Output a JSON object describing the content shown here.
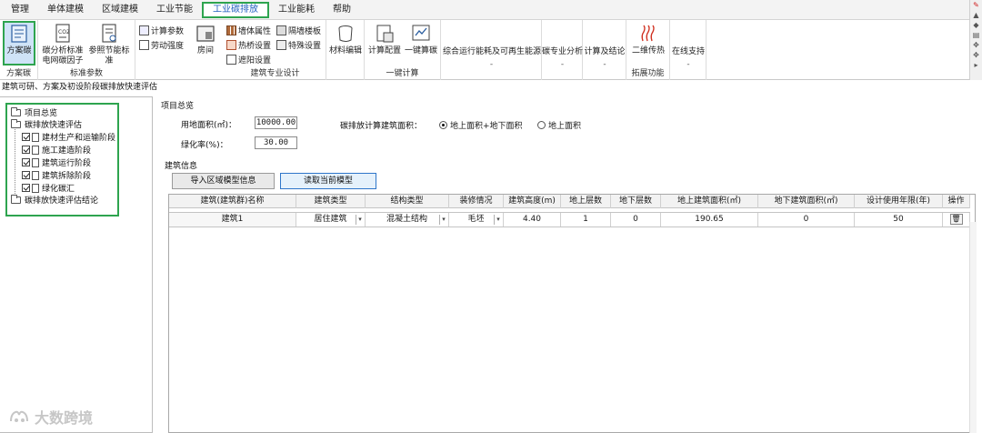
{
  "menu": {
    "items": [
      "管理",
      "单体建模",
      "区域建模",
      "工业节能",
      "工业碳排放",
      "工业能耗",
      "帮助"
    ],
    "active_index": 4
  },
  "ribbon": {
    "fangan": {
      "button": "方案碳",
      "group": "方案碳"
    },
    "biaozhun": {
      "btn1": "碳分析标准\n电网碳因子",
      "btn2": "参照节能标准",
      "group": "标准参数"
    },
    "params": {
      "calc": "计算参数",
      "labor": "劳动强度"
    },
    "room": {
      "button": "房间"
    },
    "jianzhu": {
      "wall_attr": "墙体属性",
      "heat_bridge": "热桥设置",
      "shading": "遮阳设置",
      "partition": "隔墙楼板",
      "special": "特殊设置",
      "group": "建筑专业设计"
    },
    "material": {
      "button": "材料编辑"
    },
    "yijian": {
      "calc_config": "计算配置",
      "one_click": "一键算碳",
      "group": "一键计算"
    },
    "zonghe": {
      "button": "综合运行能耗及可再生能源",
      "sub": "-"
    },
    "carbon_major": {
      "button": "碳专业分析",
      "sub": "-"
    },
    "calc_conclusion": {
      "button": "计算及结论",
      "sub": "-"
    },
    "tuozhan": {
      "button": "二维传热",
      "group": "拓展功能"
    },
    "online": {
      "button": "在线支持",
      "sub": "-"
    }
  },
  "path_title": "建筑可研、方案及初设阶段碳排放快速评估",
  "tree": {
    "project": "项目总览",
    "eval": "碳排放快速评估",
    "children": [
      "建材生产和运输阶段",
      "施工建造阶段",
      "建筑运行阶段",
      "建筑拆除阶段",
      "绿化碳汇"
    ],
    "conclusion": "碳排放快速评估结论"
  },
  "overview": {
    "section": "项目总览",
    "land_label": "用地面积(㎡)：",
    "land_value": "10000.00",
    "green_label": "绿化率(%)：",
    "green_value": "30.00",
    "area_label": "碳排放计算建筑面积：",
    "radio1": "地上面积+地下面积",
    "radio2": "地上面积"
  },
  "building": {
    "section": "建筑信息",
    "import_btn": "导入区域模型信息",
    "read_btn": "读取当前模型",
    "headers": [
      "建筑(建筑群)名称",
      "建筑类型",
      "结构类型",
      "装修情况",
      "建筑高度(m)",
      "地上层数",
      "地下层数",
      "地上建筑面积(㎡)",
      "地下建筑面积(㎡)",
      "设计使用年限(年)",
      "操作"
    ],
    "row": [
      "建筑1",
      "居住建筑",
      "混凝土结构",
      "毛坯",
      "4.40",
      "1",
      "0",
      "190.65",
      "0",
      "50",
      ""
    ]
  },
  "watermark": "大数跨境"
}
